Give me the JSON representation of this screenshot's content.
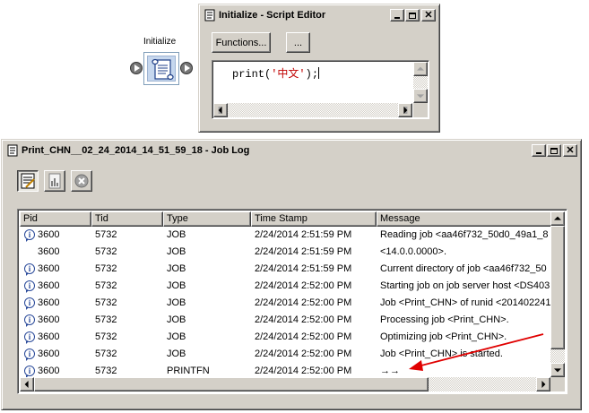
{
  "node": {
    "label": "Initialize"
  },
  "script_editor": {
    "title": "Initialize - Script Editor",
    "functions_label": "Functions...",
    "ellipsis_label": "...",
    "code_prefix": "print(",
    "code_string": "'中文'",
    "code_suffix": ");"
  },
  "job_log": {
    "title": "Print_CHN__02_24_2014_14_51_59_18 - Job Log",
    "columns": [
      "Pid",
      "Tid",
      "Type",
      "Time Stamp",
      "Message"
    ],
    "rows": [
      {
        "icon": true,
        "pid": "3600",
        "tid": "5732",
        "type": "JOB",
        "ts": "2/24/2014 2:51:59 PM",
        "msg": "Reading job <aa46f732_50d0_49a1_8"
      },
      {
        "icon": false,
        "pid": "3600",
        "tid": "5732",
        "type": "JOB",
        "ts": "2/24/2014 2:51:59 PM",
        "msg": "<14.0.0.0000>."
      },
      {
        "icon": true,
        "pid": "3600",
        "tid": "5732",
        "type": "JOB",
        "ts": "2/24/2014 2:51:59 PM",
        "msg": "Current directory of job <aa46f732_50"
      },
      {
        "icon": true,
        "pid": "3600",
        "tid": "5732",
        "type": "JOB",
        "ts": "2/24/2014 2:52:00 PM",
        "msg": "Starting job on job server host <DS403"
      },
      {
        "icon": true,
        "pid": "3600",
        "tid": "5732",
        "type": "JOB",
        "ts": "2/24/2014 2:52:00 PM",
        "msg": "Job <Print_CHN> of runid <2014022411"
      },
      {
        "icon": true,
        "pid": "3600",
        "tid": "5732",
        "type": "JOB",
        "ts": "2/24/2014 2:52:00 PM",
        "msg": "Processing job <Print_CHN>."
      },
      {
        "icon": true,
        "pid": "3600",
        "tid": "5732",
        "type": "JOB",
        "ts": "2/24/2014 2:52:00 PM",
        "msg": "Optimizing job <Print_CHN>."
      },
      {
        "icon": true,
        "pid": "3600",
        "tid": "5732",
        "type": "JOB",
        "ts": "2/24/2014 2:52:00 PM",
        "msg": "Job <Print_CHN> is started."
      },
      {
        "icon": true,
        "pid": "3600",
        "tid": "5732",
        "type": "PRINTFN",
        "ts": "2/24/2014 2:52:00 PM",
        "msg": "→→"
      }
    ]
  }
}
